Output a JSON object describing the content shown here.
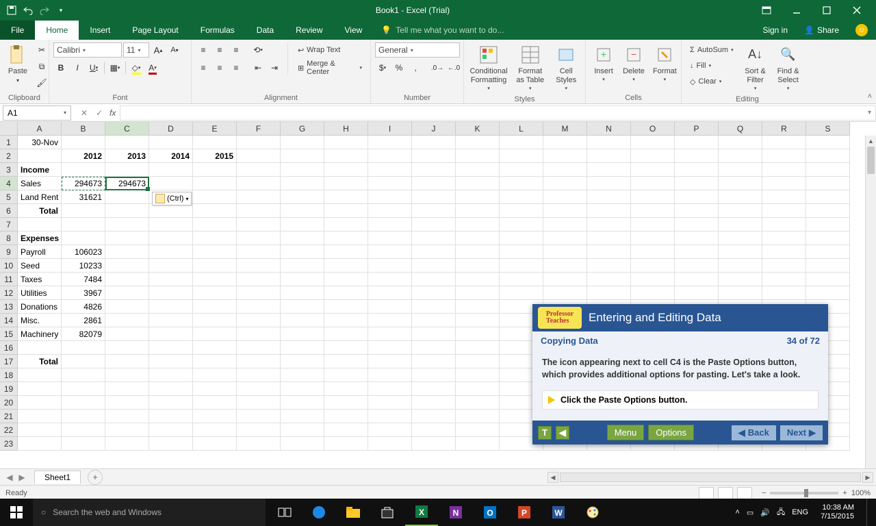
{
  "title_bar": {
    "title": "Book1 - Excel (Trial)"
  },
  "tabs": {
    "file": "File",
    "home": "Home",
    "insert": "Insert",
    "page_layout": "Page Layout",
    "formulas": "Formulas",
    "data": "Data",
    "review": "Review",
    "view": "View",
    "tell_me": "Tell me what you want to do...",
    "sign_in": "Sign in",
    "share": "Share"
  },
  "ribbon": {
    "clipboard": {
      "label": "Clipboard",
      "paste": "Paste"
    },
    "font": {
      "label": "Font",
      "name": "Calibri",
      "size": "11",
      "bold": "B",
      "italic": "I",
      "underline": "U"
    },
    "alignment": {
      "label": "Alignment",
      "wrap": "Wrap Text",
      "merge": "Merge & Center"
    },
    "number": {
      "label": "Number",
      "format": "General"
    },
    "styles": {
      "label": "Styles",
      "cond": "Conditional Formatting",
      "table": "Format as Table",
      "cell": "Cell Styles"
    },
    "cells": {
      "label": "Cells",
      "insert": "Insert",
      "delete": "Delete",
      "format": "Format"
    },
    "editing": {
      "label": "Editing",
      "autosum": "AutoSum",
      "fill": "Fill",
      "clear": "Clear",
      "sort": "Sort & Filter",
      "find": "Find & Select"
    }
  },
  "name_box": "A1",
  "columns": [
    "A",
    "B",
    "C",
    "D",
    "E",
    "F",
    "G",
    "H",
    "I",
    "J",
    "K",
    "L",
    "M",
    "N",
    "O",
    "P",
    "Q",
    "R",
    "S"
  ],
  "rows_shown": 23,
  "cells": {
    "A1": "30-Nov",
    "B2": "2012",
    "C2": "2013",
    "D2": "2014",
    "E2": "2015",
    "A3": "Income",
    "A4": "Sales",
    "B4": "294673",
    "C4": "294673",
    "A5": "Land Rent",
    "B5": "31621",
    "A6": "Total",
    "A8": "Expenses",
    "A9": "Payroll",
    "B9": "106023",
    "A10": "Seed",
    "B10": "10233",
    "A11": "Taxes",
    "B11": "7484",
    "A12": "Utilities",
    "B12": "3967",
    "A13": "Donations",
    "B13": "4826",
    "A14": "Misc.",
    "B14": "2861",
    "A15": "Machinery",
    "B15": "82079",
    "A17": "Total"
  },
  "paste_tag": "(Ctrl)",
  "sheet": {
    "name": "Sheet1"
  },
  "status": {
    "ready": "Ready",
    "zoom": "100%"
  },
  "tutorial": {
    "title": "Entering and Editing Data",
    "subtitle": "Copying Data",
    "progress": "34 of 72",
    "body": "The icon appearing next to cell C4 is the Paste Options button, which provides additional options for pasting. Let's take a look.",
    "action": "Click the Paste Options button.",
    "menu": "Menu",
    "options": "Options",
    "back": "Back",
    "next": "Next"
  },
  "taskbar": {
    "search": "Search the web and Windows",
    "lang": "ENG",
    "time": "10:38 AM",
    "date": "7/15/2015"
  }
}
